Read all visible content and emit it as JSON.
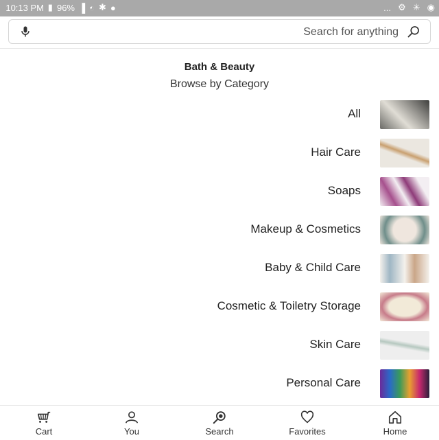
{
  "status_bar": {
    "time": "10:13 PM",
    "battery": "96%",
    "overflow": "..."
  },
  "search": {
    "placeholder": "Search for anything"
  },
  "header": {
    "title": "Bath & Beauty",
    "subtitle": "Browse by Category"
  },
  "categories": [
    {
      "label": "All",
      "thumb_colors": [
        "#4a4a48",
        "#d8d8d0"
      ]
    },
    {
      "label": "Hair Care",
      "thumb_colors": [
        "#e9e5de",
        "#c9a070"
      ]
    },
    {
      "label": "Soaps",
      "thumb_colors": [
        "#f3eef2",
        "#8e3b79"
      ]
    },
    {
      "label": "Makeup & Cosmetics",
      "thumb_colors": [
        "#efe6de",
        "#6f8e8a"
      ]
    },
    {
      "label": "Baby & Child Care",
      "thumb_colors": [
        "#f4f1ec",
        "#caa688"
      ]
    },
    {
      "label": "Cosmetic & Toiletry Storage",
      "thumb_colors": [
        "#f2ead8",
        "#c77c8a"
      ]
    },
    {
      "label": "Skin Care",
      "thumb_colors": [
        "#eeeeee",
        "#b6c8c0"
      ]
    },
    {
      "label": "Personal Care",
      "thumb_colors": [
        "#2a1f3a",
        "#c8286e"
      ]
    }
  ],
  "bottom_nav": [
    {
      "label": "Home",
      "icon": "home-icon"
    },
    {
      "label": "Favorites",
      "icon": "heart-icon"
    },
    {
      "label": "Search",
      "icon": "search-icon"
    },
    {
      "label": "You",
      "icon": "person-icon"
    },
    {
      "label": "Cart",
      "icon": "cart-icon"
    }
  ],
  "colors": {
    "status_bar_bg": "#a9a9a9",
    "text": "#222222",
    "border": "#d6d6d6"
  }
}
